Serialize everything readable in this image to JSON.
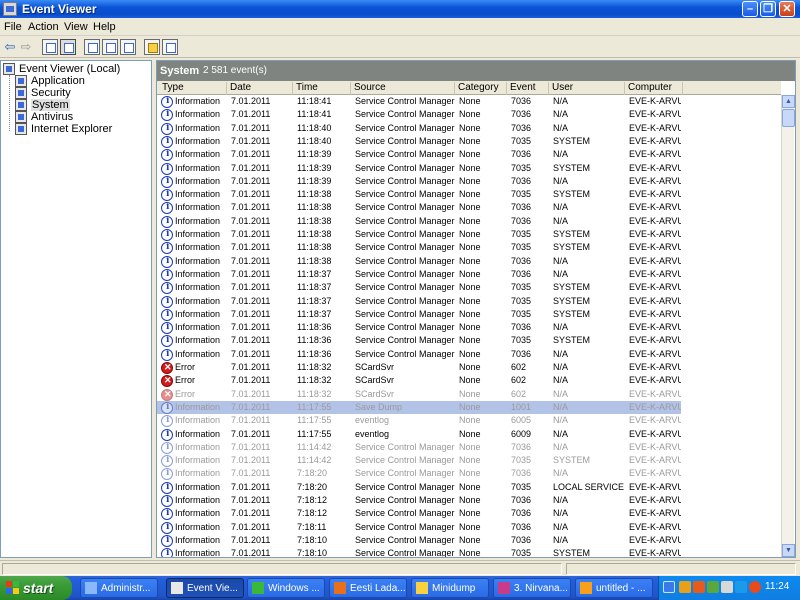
{
  "window": {
    "title": "Event Viewer"
  },
  "menu": [
    "File",
    "Action",
    "View",
    "Help"
  ],
  "tree": {
    "root": "Event Viewer (Local)",
    "children": [
      "Application",
      "Security",
      "System",
      "Antivirus",
      "Internet Explorer"
    ],
    "selected": "System"
  },
  "panel": {
    "title": "System",
    "count": "2 581 event(s)"
  },
  "columns": [
    "Type",
    "Date",
    "Time",
    "Source",
    "Category",
    "Event",
    "User",
    "Computer"
  ],
  "rows": [
    {
      "type": "Information",
      "icon": "info",
      "date": "7.01.2011",
      "time": "11:18:41",
      "source": "Service Control Manager",
      "category": "None",
      "event": "7036",
      "user": "N/A",
      "computer": "EVE-K-ARVUTI"
    },
    {
      "type": "Information",
      "icon": "info",
      "date": "7.01.2011",
      "time": "11:18:41",
      "source": "Service Control Manager",
      "category": "None",
      "event": "7036",
      "user": "N/A",
      "computer": "EVE-K-ARVUTI"
    },
    {
      "type": "Information",
      "icon": "info",
      "date": "7.01.2011",
      "time": "11:18:40",
      "source": "Service Control Manager",
      "category": "None",
      "event": "7036",
      "user": "N/A",
      "computer": "EVE-K-ARVUTI"
    },
    {
      "type": "Information",
      "icon": "info",
      "date": "7.01.2011",
      "time": "11:18:40",
      "source": "Service Control Manager",
      "category": "None",
      "event": "7035",
      "user": "SYSTEM",
      "computer": "EVE-K-ARVUTI"
    },
    {
      "type": "Information",
      "icon": "info",
      "date": "7.01.2011",
      "time": "11:18:39",
      "source": "Service Control Manager",
      "category": "None",
      "event": "7036",
      "user": "N/A",
      "computer": "EVE-K-ARVUTI"
    },
    {
      "type": "Information",
      "icon": "info",
      "date": "7.01.2011",
      "time": "11:18:39",
      "source": "Service Control Manager",
      "category": "None",
      "event": "7035",
      "user": "SYSTEM",
      "computer": "EVE-K-ARVUTI"
    },
    {
      "type": "Information",
      "icon": "info",
      "date": "7.01.2011",
      "time": "11:18:39",
      "source": "Service Control Manager",
      "category": "None",
      "event": "7036",
      "user": "N/A",
      "computer": "EVE-K-ARVUTI"
    },
    {
      "type": "Information",
      "icon": "info",
      "date": "7.01.2011",
      "time": "11:18:38",
      "source": "Service Control Manager",
      "category": "None",
      "event": "7035",
      "user": "SYSTEM",
      "computer": "EVE-K-ARVUTI"
    },
    {
      "type": "Information",
      "icon": "info",
      "date": "7.01.2011",
      "time": "11:18:38",
      "source": "Service Control Manager",
      "category": "None",
      "event": "7036",
      "user": "N/A",
      "computer": "EVE-K-ARVUTI"
    },
    {
      "type": "Information",
      "icon": "info",
      "date": "7.01.2011",
      "time": "11:18:38",
      "source": "Service Control Manager",
      "category": "None",
      "event": "7036",
      "user": "N/A",
      "computer": "EVE-K-ARVUTI"
    },
    {
      "type": "Information",
      "icon": "info",
      "date": "7.01.2011",
      "time": "11:18:38",
      "source": "Service Control Manager",
      "category": "None",
      "event": "7035",
      "user": "SYSTEM",
      "computer": "EVE-K-ARVUTI"
    },
    {
      "type": "Information",
      "icon": "info",
      "date": "7.01.2011",
      "time": "11:18:38",
      "source": "Service Control Manager",
      "category": "None",
      "event": "7035",
      "user": "SYSTEM",
      "computer": "EVE-K-ARVUTI"
    },
    {
      "type": "Information",
      "icon": "info",
      "date": "7.01.2011",
      "time": "11:18:38",
      "source": "Service Control Manager",
      "category": "None",
      "event": "7036",
      "user": "N/A",
      "computer": "EVE-K-ARVUTI"
    },
    {
      "type": "Information",
      "icon": "info",
      "date": "7.01.2011",
      "time": "11:18:37",
      "source": "Service Control Manager",
      "category": "None",
      "event": "7036",
      "user": "N/A",
      "computer": "EVE-K-ARVUTI"
    },
    {
      "type": "Information",
      "icon": "info",
      "date": "7.01.2011",
      "time": "11:18:37",
      "source": "Service Control Manager",
      "category": "None",
      "event": "7035",
      "user": "SYSTEM",
      "computer": "EVE-K-ARVUTI"
    },
    {
      "type": "Information",
      "icon": "info",
      "date": "7.01.2011",
      "time": "11:18:37",
      "source": "Service Control Manager",
      "category": "None",
      "event": "7035",
      "user": "SYSTEM",
      "computer": "EVE-K-ARVUTI"
    },
    {
      "type": "Information",
      "icon": "info",
      "date": "7.01.2011",
      "time": "11:18:37",
      "source": "Service Control Manager",
      "category": "None",
      "event": "7035",
      "user": "SYSTEM",
      "computer": "EVE-K-ARVUTI"
    },
    {
      "type": "Information",
      "icon": "info",
      "date": "7.01.2011",
      "time": "11:18:36",
      "source": "Service Control Manager",
      "category": "None",
      "event": "7036",
      "user": "N/A",
      "computer": "EVE-K-ARVUTI"
    },
    {
      "type": "Information",
      "icon": "info",
      "date": "7.01.2011",
      "time": "11:18:36",
      "source": "Service Control Manager",
      "category": "None",
      "event": "7035",
      "user": "SYSTEM",
      "computer": "EVE-K-ARVUTI"
    },
    {
      "type": "Information",
      "icon": "info",
      "date": "7.01.2011",
      "time": "11:18:36",
      "source": "Service Control Manager",
      "category": "None",
      "event": "7036",
      "user": "N/A",
      "computer": "EVE-K-ARVUTI"
    },
    {
      "type": "Error",
      "icon": "err",
      "date": "7.01.2011",
      "time": "11:18:32",
      "source": "SCardSvr",
      "category": "None",
      "event": "602",
      "user": "N/A",
      "computer": "EVE-K-ARVUTI"
    },
    {
      "type": "Error",
      "icon": "err",
      "date": "7.01.2011",
      "time": "11:18:32",
      "source": "SCardSvr",
      "category": "None",
      "event": "602",
      "user": "N/A",
      "computer": "EVE-K-ARVUTI"
    },
    {
      "type": "Error",
      "icon": "err",
      "date": "7.01.2011",
      "time": "11:18:32",
      "source": "SCardSvr",
      "category": "None",
      "event": "602",
      "user": "N/A",
      "computer": "EVE-K-ARVUTI",
      "faded": true
    },
    {
      "type": "Information",
      "icon": "info",
      "date": "7.01.2011",
      "time": "11:17:55",
      "source": "Save Dump",
      "category": "None",
      "event": "1001",
      "user": "N/A",
      "computer": "EVE-K-ARVUTI",
      "faded": true,
      "selected": true
    },
    {
      "type": "Information",
      "icon": "info",
      "date": "7.01.2011",
      "time": "11:17:55",
      "source": "eventlog",
      "category": "None",
      "event": "6005",
      "user": "N/A",
      "computer": "EVE-K-ARVUTI",
      "faded": true
    },
    {
      "type": "Information",
      "icon": "info",
      "date": "7.01.2011",
      "time": "11:17:55",
      "source": "eventlog",
      "category": "None",
      "event": "6009",
      "user": "N/A",
      "computer": "EVE-K-ARVUTI"
    },
    {
      "type": "Information",
      "icon": "info",
      "date": "7.01.2011",
      "time": "11:14:42",
      "source": "Service Control Manager",
      "category": "None",
      "event": "7036",
      "user": "N/A",
      "computer": "EVE-K-ARVUTI",
      "faded": true
    },
    {
      "type": "Information",
      "icon": "info",
      "date": "7.01.2011",
      "time": "11:14:42",
      "source": "Service Control Manager",
      "category": "None",
      "event": "7035",
      "user": "SYSTEM",
      "computer": "EVE-K-ARVUTI",
      "faded": true
    },
    {
      "type": "Information",
      "icon": "info",
      "date": "7.01.2011",
      "time": "7:18:20",
      "source": "Service Control Manager",
      "category": "None",
      "event": "7036",
      "user": "N/A",
      "computer": "EVE-K-ARVUTI",
      "faded": true
    },
    {
      "type": "Information",
      "icon": "info",
      "date": "7.01.2011",
      "time": "7:18:20",
      "source": "Service Control Manager",
      "category": "None",
      "event": "7035",
      "user": "LOCAL SERVICE",
      "computer": "EVE-K-ARVUTI"
    },
    {
      "type": "Information",
      "icon": "info",
      "date": "7.01.2011",
      "time": "7:18:12",
      "source": "Service Control Manager",
      "category": "None",
      "event": "7036",
      "user": "N/A",
      "computer": "EVE-K-ARVUTI"
    },
    {
      "type": "Information",
      "icon": "info",
      "date": "7.01.2011",
      "time": "7:18:12",
      "source": "Service Control Manager",
      "category": "None",
      "event": "7036",
      "user": "N/A",
      "computer": "EVE-K-ARVUTI"
    },
    {
      "type": "Information",
      "icon": "info",
      "date": "7.01.2011",
      "time": "7:18:11",
      "source": "Service Control Manager",
      "category": "None",
      "event": "7036",
      "user": "N/A",
      "computer": "EVE-K-ARVUTI"
    },
    {
      "type": "Information",
      "icon": "info",
      "date": "7.01.2011",
      "time": "7:18:10",
      "source": "Service Control Manager",
      "category": "None",
      "event": "7036",
      "user": "N/A",
      "computer": "EVE-K-ARVUTI"
    },
    {
      "type": "Information",
      "icon": "info",
      "date": "7.01.2011",
      "time": "7:18:10",
      "source": "Service Control Manager",
      "category": "None",
      "event": "7035",
      "user": "SYSTEM",
      "computer": "EVE-K-ARVUTI"
    }
  ],
  "taskbar": {
    "start": "start",
    "tasks": [
      {
        "label": "Administr...",
        "icon": "computer-icon"
      },
      {
        "label": "Event Vie...",
        "icon": "event-viewer-icon",
        "active": true
      },
      {
        "label": "Windows ...",
        "icon": "windows-icon"
      },
      {
        "label": "Eesti Lada...",
        "icon": "firefox-icon"
      },
      {
        "label": "Minidump",
        "icon": "folder-icon"
      },
      {
        "label": "3. Nirvana...",
        "icon": "music-icon"
      },
      {
        "label": "untitled - ...",
        "icon": "paint-icon"
      }
    ],
    "clock": "11:24"
  }
}
